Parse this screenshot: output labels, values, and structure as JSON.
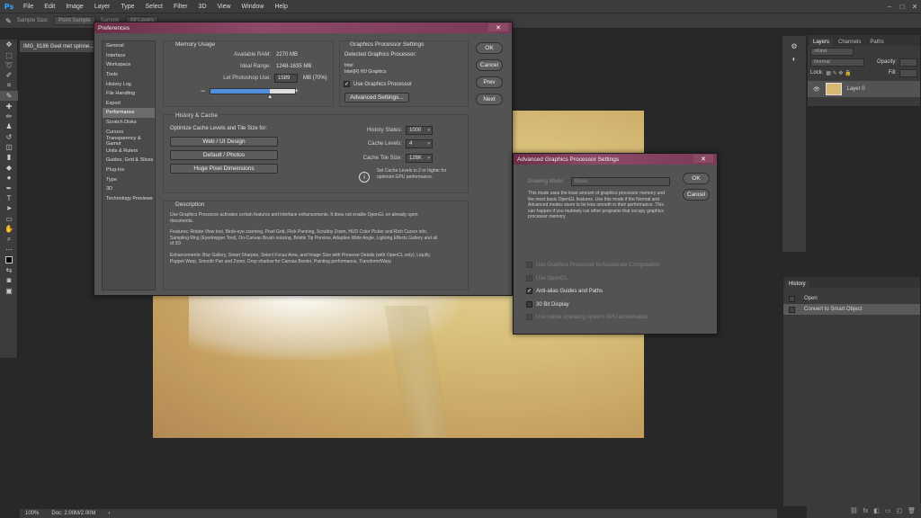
{
  "app": {
    "logo": "Ps"
  },
  "menubar": {
    "items": [
      "File",
      "Edit",
      "Image",
      "Layer",
      "Type",
      "Select",
      "Filter",
      "3D",
      "View",
      "Window",
      "Help"
    ]
  },
  "optionsbar": {
    "sample_size": "Sample Size:",
    "sample_value": "Point Sample",
    "sample_label2": "Sample:",
    "sample2_value": "All Layers"
  },
  "document": {
    "tab_title": "IMG_8186 Geel met spinne...",
    "zoom": "100%",
    "doc_info": "Doc: 2.00M/2.00M"
  },
  "layers_panel": {
    "tabs": [
      "Layers",
      "Channels",
      "Paths"
    ],
    "kind": "Kind",
    "blend_mode": "Normal",
    "opacity_label": "Opacity:",
    "lock_label": "Lock:",
    "fill_label": "Fill:",
    "layer_name": "Layer 0"
  },
  "history_panel": {
    "title": "History",
    "items": [
      "Open",
      "Convert to Smart Object"
    ]
  },
  "preferences": {
    "title": "Preferences",
    "categories": [
      "General",
      "Interface",
      "Workspace",
      "Tools",
      "History Log",
      "File Handling",
      "Export",
      "Performance",
      "Scratch Disks",
      "Cursors",
      "Transparency & Gamut",
      "Units & Rulers",
      "Guides, Grid & Slices",
      "Plug-Ins",
      "Type",
      "3D",
      "Technology Previews"
    ],
    "selected_category": "Performance",
    "memory": {
      "title": "Memory Usage",
      "available_label": "Available RAM:",
      "available_value": "2270 MB",
      "ideal_label": "Ideal Range:",
      "ideal_value": "1248-1635 MB",
      "let_label": "Let Photoshop Use:",
      "let_value": "1589",
      "let_unit": "MB (70%)",
      "slider_percent": 70
    },
    "gpu": {
      "title": "Graphics Processor Settings",
      "detected_label": "Detected Graphics Processor:",
      "vendor": "Intel",
      "model": "Intel(R) HD Graphics",
      "use_gpu": "Use Graphics Processor",
      "use_gpu_checked": true,
      "advanced_button": "Advanced Settings..."
    },
    "history_cache": {
      "title": "History & Cache",
      "optimize_label": "Optimize Cache Levels and Tile Size for:",
      "buttons": [
        "Web / UI Design",
        "Default / Photos",
        "Huge Pixel Dimensions"
      ],
      "history_states_label": "History States:",
      "history_states_value": "1000",
      "cache_levels_label": "Cache Levels:",
      "cache_levels_value": "4",
      "tile_size_label": "Cache Tile Size:",
      "tile_size_value": "128K",
      "info_text": "Set Cache Levels to 2 or higher for optimum GPU performance."
    },
    "description": {
      "title": "Description",
      "p1": "Use Graphics Processor activates certain features and interface enhancements. It does not enable OpenGL on already open documents.",
      "p2": "Features: Rotate View tool, Birds-eye zooming, Pixel Grid, Flick Panning, Scrubby Zoom, HUD Color Picker and Rich Cursor info, Sampling Ring (Eyedropper Tool), On-Canvas Brush resizing, Bristle Tip Preview, Adaptive Wide Angle, Lighting Effects Gallery and all of 3D",
      "p3": "Enhancements: Blur Gallery, Smart Sharpen, Select Focus Area, and Image Size with Preserve Details (with OpenCL only), Liquify, Puppet Warp, Smooth Pan and Zoom, Drop shadow for Canvas Border, Painting performance, Transform/Warp"
    },
    "buttons": {
      "ok": "OK",
      "cancel": "Cancel",
      "prev": "Prev",
      "next": "Next"
    }
  },
  "advanced_gpu": {
    "title": "Advanced Graphics Processor Settings",
    "drawing_mode_label": "Drawing Mode:",
    "drawing_mode_value": "Basic",
    "info": "This mode uses the least amount of graphics processor memory and the most basic OpenGL features. Use this mode if the Normal and Advanced modes seem to be less smooth in their performance. This can happen if you routinely run other programs that occupy graphics processor memory.",
    "options": [
      {
        "label": "Use Graphics Processor to Accelerate Computation",
        "checked": false,
        "enabled": false
      },
      {
        "label": "Use OpenCL",
        "checked": false,
        "enabled": false
      },
      {
        "label": "Anti-alias Guides and Paths",
        "checked": true,
        "enabled": true
      },
      {
        "label": "30 Bit Display",
        "checked": false,
        "enabled": true
      },
      {
        "label": "Use native operating system GPU acceleration",
        "checked": false,
        "enabled": false
      }
    ],
    "ok": "OK",
    "cancel": "Cancel"
  }
}
